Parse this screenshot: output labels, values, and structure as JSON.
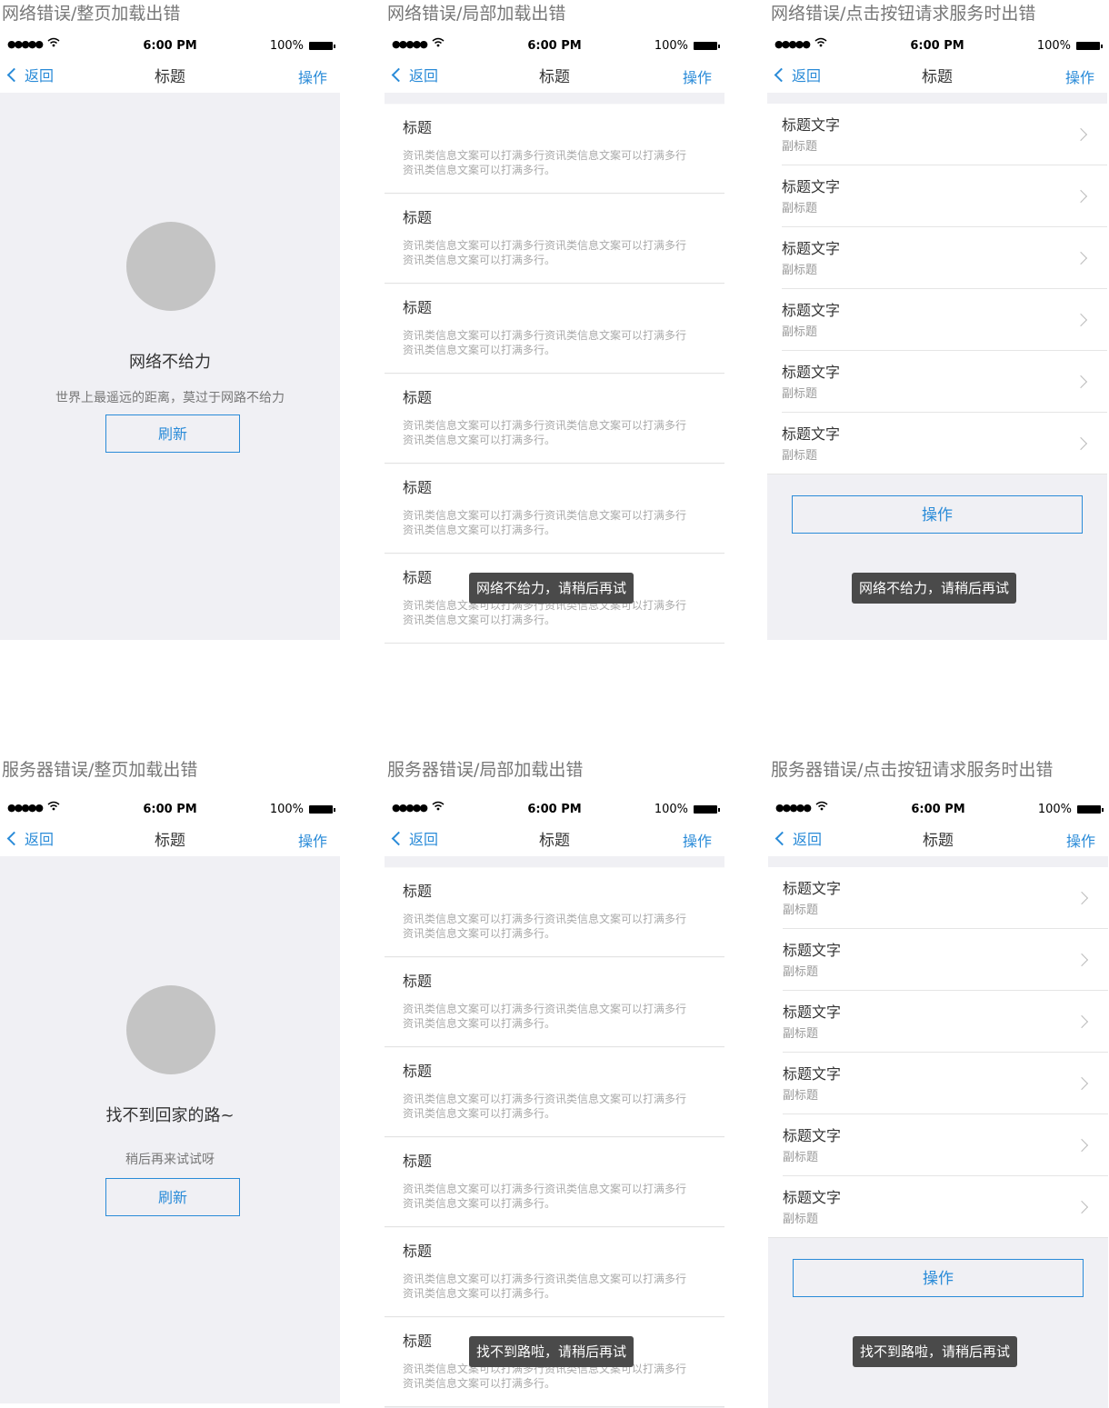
{
  "status": {
    "dots": "●●●●●",
    "time": "6:00 PM",
    "battery": "100%"
  },
  "nav": {
    "back": "返回",
    "title": "标题",
    "action": "操作"
  },
  "sections": [
    "网络错误/整页加载出错",
    "网络错误/局部加载出错",
    "网络错误/点击按钮请求服务时出错",
    "服务器错误/整页加载出错",
    "服务器错误/局部加载出错",
    "服务器错误/点击按钮请求服务时出错"
  ],
  "network_full": {
    "title": "网络不给力",
    "subtitle": "世界上最遥远的距离，莫过于网路不给力",
    "button": "刷新"
  },
  "server_full": {
    "title": "找不到回家的路~",
    "subtitle": "稍后再来试试呀",
    "button": "刷新"
  },
  "news": {
    "title": "标题",
    "desc_line1": "资讯类信息文案可以打满多行资讯类信息文案可以打满多行",
    "desc_line2": "资讯类信息文案可以打满多行。"
  },
  "list": {
    "title": "标题文字",
    "subtitle": "副标题"
  },
  "action_button": "操作",
  "toasts": {
    "network": "网络不给力，请稍后再试",
    "server": "找不到路啦，请稍后再试"
  }
}
